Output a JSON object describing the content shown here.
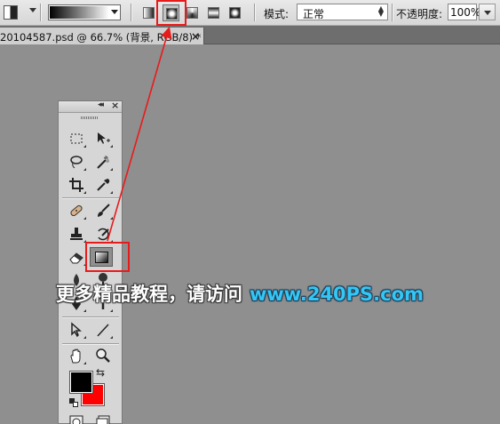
{
  "options_bar": {
    "mode_label": "模式:",
    "mode_value": "正常",
    "opacity_label": "不透明度:",
    "opacity_value": "100%",
    "gradient_types": [
      "linear-gradient-icon",
      "radial-gradient-icon",
      "angle-gradient-icon",
      "reflected-gradient-icon",
      "diamond-gradient-icon"
    ],
    "selected_gradient_type": "radial-gradient-icon"
  },
  "document": {
    "tab_title": "20104587.psd @ 66.7% (背景, RGB/8) *",
    "close_glyph": "×"
  },
  "tools_panel": {
    "collapse_glyph": "◂◂",
    "close_glyph": "×",
    "foreground_color": "#000000",
    "background_color": "#ff0000",
    "active_tool": "gradient-tool"
  },
  "highlight_color": "#e81b1b",
  "watermark": {
    "text": "更多精品教程，请访问",
    "url": "www.240PS.com",
    "url_color": "#34c6f4"
  }
}
